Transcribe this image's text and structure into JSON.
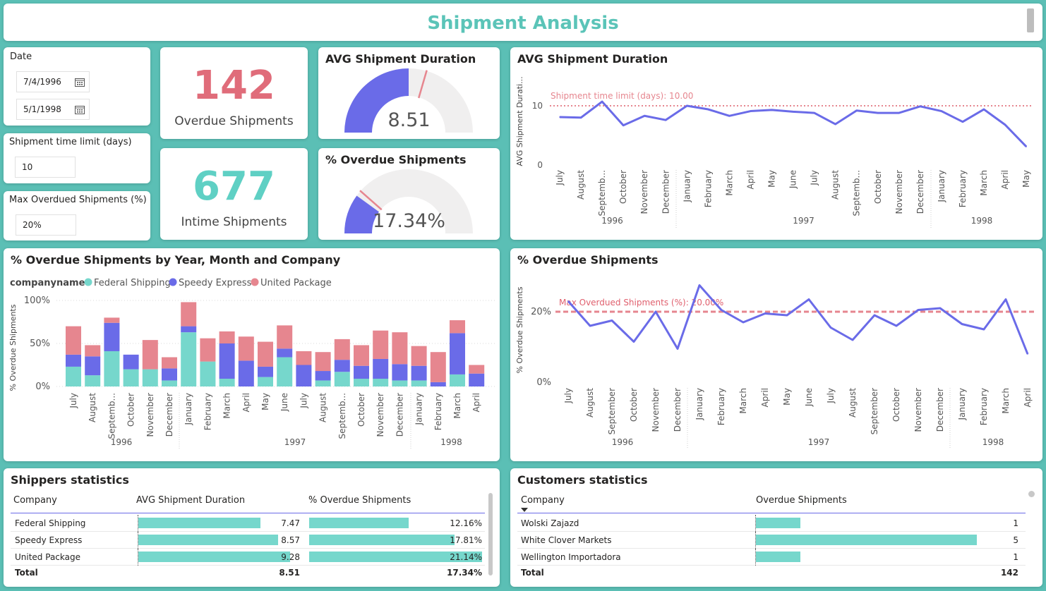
{
  "header": {
    "title": "Shipment Analysis"
  },
  "filters": {
    "date_label": "Date",
    "date_start": "7/4/1996",
    "date_end": "5/1/1998",
    "time_limit_label": "Shipment time limit (days)",
    "time_limit_value": "10",
    "max_overdue_label": "Max Overdued Shipments (%)",
    "max_overdue_value": "20%"
  },
  "kpis": {
    "overdue_value": "142",
    "overdue_label": "Overdue Shipments",
    "intime_value": "677",
    "intime_label": "Intime Shipments"
  },
  "gauges": {
    "avg_title": "AVG Shipment Duration",
    "avg_value": "8.51",
    "avg_fraction": 0.5,
    "avg_target_fraction": 0.59,
    "overdue_title": "% Overdue Shipments",
    "overdue_value": "17.34%",
    "overdue_fraction": 0.2,
    "overdue_target_fraction": 0.23
  },
  "colors": {
    "accent_teal": "#5bc4b8",
    "series_blue": "#6a6be8",
    "series_pink": "#e6868f",
    "teal_bar": "#76d7cc",
    "kpi_red": "#e06c7a",
    "kpi_teal": "#5fd0c4"
  },
  "chart_avg_duration": {
    "title": "AVG Shipment Duration",
    "ylabel": "AVG Shipment Durati...",
    "ref_label": "Shipment time limit (days): 10.00",
    "months": [
      "July",
      "August",
      "Septemb...",
      "October",
      "November",
      "December",
      "January",
      "February",
      "March",
      "April",
      "May",
      "June",
      "July",
      "August",
      "Septemb...",
      "October",
      "November",
      "December",
      "January",
      "February",
      "March",
      "April",
      "May"
    ],
    "years": [
      "1996",
      "1997",
      "1998"
    ],
    "yticks": [
      "0",
      "10"
    ]
  },
  "chart_stacked": {
    "title": "% Overdue Shipments by Year, Month and Company",
    "legend_title": "companyname",
    "legend": [
      "Federal Shipping",
      "Speedy Express",
      "United Package"
    ],
    "ylabel": "% Overdue Shipments",
    "months": [
      "July",
      "August",
      "Septemb...",
      "October",
      "November",
      "December",
      "January",
      "February",
      "March",
      "April",
      "May",
      "June",
      "July",
      "August",
      "Septemb...",
      "October",
      "November",
      "December",
      "January",
      "February",
      "March",
      "April"
    ],
    "years": [
      "1996",
      "1997",
      "1998"
    ],
    "yticks": [
      "0%",
      "50%",
      "100%"
    ]
  },
  "chart_overdue": {
    "title": "% Overdue Shipments",
    "ylabel": "% Overdue Shipments",
    "ref_label": "Max Overdued Shipments (%): 20.00%",
    "months": [
      "July",
      "August",
      "September",
      "October",
      "November",
      "December",
      "January",
      "February",
      "March",
      "April",
      "May",
      "June",
      "July",
      "August",
      "September",
      "October",
      "November",
      "December",
      "January",
      "February",
      "March",
      "April"
    ],
    "years": [
      "1996",
      "1997",
      "1998"
    ],
    "yticks": [
      "0%",
      "20%"
    ]
  },
  "chart_data": [
    {
      "type": "line",
      "title": "AVG Shipment Duration",
      "ylabel": "AVG Shipment Durati...",
      "x": [
        "1996 July",
        "1996 August",
        "1996 September",
        "1996 October",
        "1996 November",
        "1996 December",
        "1997 January",
        "1997 February",
        "1997 March",
        "1997 April",
        "1997 May",
        "1997 June",
        "1997 July",
        "1997 August",
        "1997 September",
        "1997 October",
        "1997 November",
        "1997 December",
        "1998 January",
        "1998 February",
        "1998 March",
        "1998 April",
        "1998 May"
      ],
      "series": [
        {
          "values": [
            8.1,
            8.0,
            10.7,
            6.7,
            8.3,
            7.6,
            10.0,
            9.4,
            8.3,
            9.1,
            9.3,
            9.0,
            8.8,
            6.9,
            9.2,
            8.8,
            8.8,
            9.9,
            9.1,
            7.3,
            9.4,
            6.8,
            3.1
          ]
        }
      ],
      "reference_line": 10,
      "ylim": [
        0,
        11
      ]
    },
    {
      "type": "bar",
      "stacked": true,
      "title": "% Overdue Shipments by Year, Month and Company",
      "ylabel": "% Overdue Shipments",
      "categories": [
        "1996 July",
        "1996 August",
        "1996 September",
        "1996 October",
        "1996 November",
        "1996 December",
        "1997 January",
        "1997 February",
        "1997 March",
        "1997 April",
        "1997 May",
        "1997 June",
        "1997 July",
        "1997 August",
        "1997 September",
        "1997 October",
        "1997 November",
        "1997 December",
        "1998 January",
        "1998 February",
        "1998 March",
        "1998 April"
      ],
      "series": [
        {
          "name": "Federal Shipping",
          "values": [
            23,
            13,
            41,
            20,
            20,
            7,
            63,
            29,
            9,
            0,
            11,
            34,
            0,
            7,
            17,
            9,
            9,
            7,
            7,
            0,
            14,
            0
          ]
        },
        {
          "name": "Speedy Express",
          "values": [
            14,
            22,
            33,
            17,
            0,
            14,
            7,
            0,
            41,
            30,
            12,
            10,
            25,
            11,
            14,
            15,
            23,
            19,
            17,
            5,
            48,
            15
          ]
        },
        {
          "name": "United Package",
          "values": [
            33,
            13,
            6,
            0,
            34,
            13,
            28,
            27,
            14,
            28,
            29,
            27,
            16,
            22,
            24,
            24,
            33,
            37,
            23,
            35,
            15,
            10
          ]
        }
      ],
      "ylim": [
        0,
        100
      ]
    },
    {
      "type": "line",
      "title": "% Overdue Shipments",
      "ylabel": "% Overdue Shipments",
      "x": [
        "1996 July",
        "1996 August",
        "1996 September",
        "1996 October",
        "1996 November",
        "1996 December",
        "1997 January",
        "1997 February",
        "1997 March",
        "1997 April",
        "1997 May",
        "1997 June",
        "1997 July",
        "1997 August",
        "1997 September",
        "1997 October",
        "1997 November",
        "1997 December",
        "1998 January",
        "1998 February",
        "1998 March",
        "1998 April"
      ],
      "series": [
        {
          "values": [
            23,
            16,
            17.5,
            11.5,
            20,
            9.5,
            27.5,
            20.5,
            17,
            19.5,
            19,
            23.5,
            15.5,
            12,
            19,
            16,
            20.5,
            21,
            16.5,
            15,
            23.5,
            8
          ]
        }
      ],
      "reference_line": 20,
      "ylim": [
        0,
        29
      ]
    }
  ],
  "shippers": {
    "title": "Shippers statistics",
    "headers": [
      "Company",
      "AVG Shipment Duration",
      "% Overdue Shipments"
    ],
    "rows": [
      {
        "company": "Federal Shipping",
        "avg": "7.47",
        "avg_frac": 0.805,
        "pct": "12.16%",
        "pct_frac": 0.575
      },
      {
        "company": "Speedy Express",
        "avg": "8.57",
        "avg_frac": 0.923,
        "pct": "17.81%",
        "pct_frac": 0.842
      },
      {
        "company": "United Package",
        "avg": "9.28",
        "avg_frac": 1.0,
        "pct": "21.14%",
        "pct_frac": 1.0
      }
    ],
    "total_label": "Total",
    "total_avg": "8.51",
    "total_pct": "17.34%"
  },
  "customers": {
    "title": "Customers statistics",
    "headers": [
      "Company",
      "Overdue Shipments"
    ],
    "rows": [
      {
        "company": "Wolski Zajazd",
        "value": "1",
        "frac": 0.2
      },
      {
        "company": "White Clover Markets",
        "value": "5",
        "frac": 1.0
      },
      {
        "company": "Wellington Importadora",
        "value": "1",
        "frac": 0.2
      }
    ],
    "total_label": "Total",
    "total_value": "142"
  }
}
